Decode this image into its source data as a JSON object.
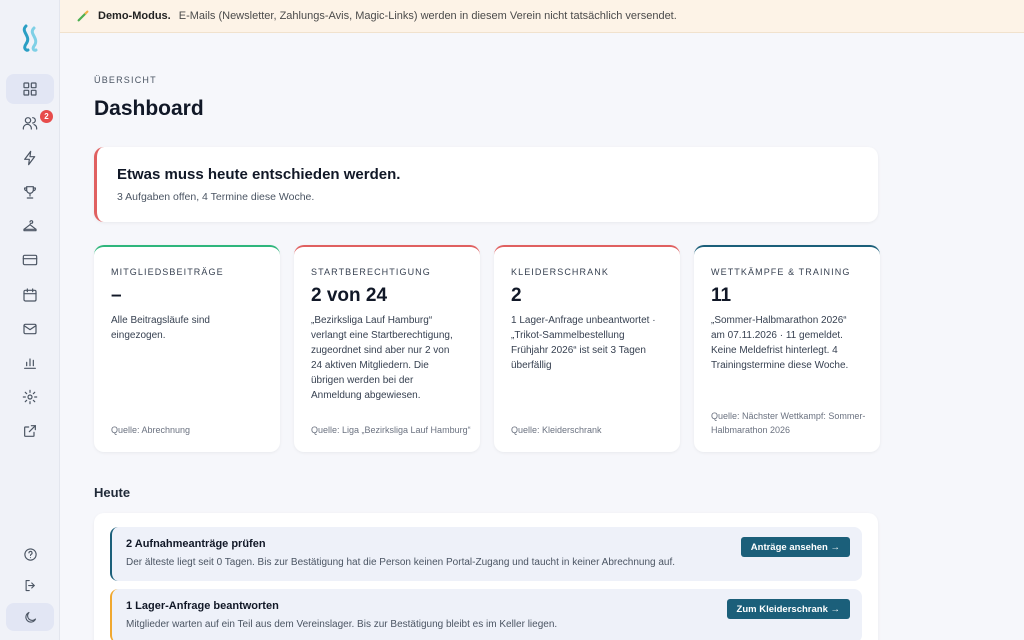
{
  "banner": {
    "mode_label": "Demo-Modus.",
    "message": "E-Mails (Newsletter, Zahlungs-Avis, Magic-Links) werden in diesem Verein nicht tatsächlich versendet."
  },
  "sidebar": {
    "members_badge": "2",
    "icons": [
      "dashboard-icon",
      "members-icon",
      "activity-icon",
      "trophy-icon",
      "training-icon",
      "billing-icon",
      "calendar-icon",
      "mail-icon",
      "stats-icon",
      "settings-icon",
      "external-link-icon"
    ],
    "bottom_icons": [
      "help-icon",
      "logout-icon",
      "dark-mode-icon"
    ]
  },
  "page": {
    "eyebrow": "ÜBERSICHT",
    "title": "Dashboard"
  },
  "alert": {
    "title": "Etwas muss heute entschieden werden.",
    "subtitle": "3 Aufgaben offen, 4 Termine diese Woche."
  },
  "cards": [
    {
      "label": "MITGLIEDSBEITRÄGE",
      "value": "–",
      "desc": "Alle Beitragsläufe sind eingezogen.",
      "source": "Quelle: Abrechnung",
      "accent": "#2fb67c"
    },
    {
      "label": "STARTBERECHTIGUNG",
      "value": "2 von 24",
      "desc": "„Bezirksliga Lauf Hamburg“ verlangt eine Startberechtigung, zugeordnet sind aber nur 2 von 24 aktiven Mitgliedern. Die übrigen werden bei der Anmeldung abgewiesen.",
      "source": "Quelle: Liga „Bezirksliga Lauf Hamburg“",
      "accent": "#e06060"
    },
    {
      "label": "KLEIDERSCHRANK",
      "value": "2",
      "desc": "1 Lager-Anfrage unbeantwortet · „Trikot-Sammelbestellung Frühjahr 2026“ ist seit 3 Tagen überfällig",
      "source": "Quelle: Kleiderschrank",
      "accent": "#e06060"
    },
    {
      "label": "WETTKÄMPFE & TRAINING",
      "value": "11",
      "desc": "„Sommer-Halbmarathon 2026“ am 07.11.2026 · 11 gemeldet. Keine Meldefrist hinterlegt. 4 Trainingstermine diese Woche.",
      "source": "Quelle: Nächster Wettkampf: Sommer-Halbmarathon 2026",
      "accent": "#1b5f7a"
    }
  ],
  "today": {
    "title": "Heute",
    "tasks": [
      {
        "title": "2 Aufnahmeanträge prüfen",
        "desc": "Der älteste liegt seit 0 Tagen. Bis zur Bestätigung hat die Person keinen Portal-Zugang und taucht in keiner Abrechnung auf.",
        "button": "Anträge ansehen →"
      },
      {
        "title": "1 Lager-Anfrage beantworten",
        "desc": "Mitglieder warten auf ein Teil aus dem Vereinslager. Bis zur Bestätigung bleibt es im Keller liegen.",
        "button": "Zum Kleiderschrank →"
      }
    ]
  },
  "colors": {
    "primary": "#1b5f7a",
    "danger": "#e06060",
    "success": "#2fb67c",
    "warning": "#f0a830"
  }
}
